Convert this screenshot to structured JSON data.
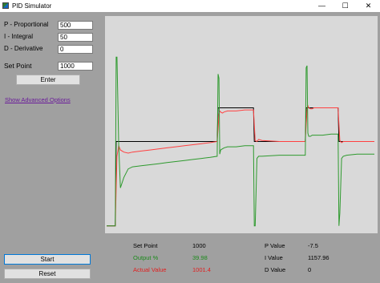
{
  "window": {
    "title": "PID Simulator",
    "minimize_glyph": "—",
    "maximize_glyph": "☐",
    "close_glyph": "✕"
  },
  "controls": {
    "p_label": "P - Proportional",
    "p_value": "500",
    "i_label": "I - Integral",
    "i_value": "50",
    "d_label": "D - Derivative",
    "d_value": "0",
    "setpoint_label": "Set Point",
    "setpoint_value": "1000",
    "enter_label": "Enter",
    "advanced_link": "Show Advanced Options",
    "start_label": "Start",
    "reset_label": "Reset"
  },
  "readouts": {
    "set_point_label": "Set Point",
    "set_point_value": "1000",
    "output_label": "Output %",
    "output_value": "39.98",
    "actual_label": "Actual Value",
    "actual_value": "1001.4",
    "p_label": "P Value",
    "p_value": "-7.5",
    "i_label": "I Value",
    "i_value": "1157.96",
    "d_label": "D Value",
    "d_value": "0"
  },
  "colors": {
    "setpoint_line": "#000000",
    "actual_line": "#ff4040",
    "output_line": "#2e9a2e",
    "chart_bg": "#d9d9d9",
    "window_bg": "#a0a0a0"
  },
  "chart_data": {
    "type": "line",
    "title": "",
    "xlabel": "",
    "ylabel": "",
    "x": [
      0,
      5,
      8,
      10,
      11,
      12,
      14,
      16,
      20,
      25,
      30,
      40,
      50,
      60,
      70,
      80,
      90,
      100,
      110,
      120,
      128,
      129,
      130,
      131,
      132,
      134,
      136,
      140,
      150,
      160,
      170,
      171,
      172,
      174,
      176,
      180,
      200,
      230,
      231,
      232,
      233,
      234,
      236,
      238,
      240,
      250,
      260,
      268,
      269,
      270,
      272,
      274,
      278,
      290,
      300,
      310
    ],
    "ylim": [
      0,
      100
    ],
    "series": [
      {
        "values": [
          2,
          2,
          2,
          2,
          42,
          42,
          42,
          42,
          42,
          42,
          42,
          42,
          42,
          42,
          42,
          42,
          42,
          42,
          42,
          42,
          42,
          58,
          58,
          58,
          58,
          58,
          58,
          58,
          58,
          58,
          58,
          42,
          42,
          42,
          42,
          42,
          42,
          42,
          58,
          58,
          58,
          58,
          58,
          58,
          58,
          58,
          58,
          58,
          42,
          42,
          42,
          42,
          42,
          42,
          42,
          42
        ]
      },
      {
        "values": [
          2,
          2,
          2,
          2,
          20,
          35,
          40,
          38,
          37,
          36.5,
          37,
          37.5,
          38,
          38.5,
          39,
          39.5,
          40,
          40.5,
          41,
          41.5,
          42,
          48,
          55,
          56.5,
          56,
          55.5,
          56,
          56.5,
          56.5,
          57,
          57,
          50,
          42.5,
          42,
          43,
          42.5,
          42,
          42,
          50,
          57,
          59,
          58,
          57.5,
          57.5,
          58,
          58,
          58,
          58,
          50,
          42.5,
          41.5,
          42,
          42,
          42,
          42,
          42
        ]
      },
      {
        "values": [
          2,
          2,
          2,
          2,
          82,
          82,
          40,
          20,
          25,
          29,
          30,
          30.5,
          31,
          31.5,
          32,
          32.5,
          33,
          33.5,
          34,
          34.5,
          35,
          74,
          72,
          36,
          38,
          38.5,
          39,
          39.5,
          39.5,
          40,
          40,
          2,
          2,
          34,
          35,
          35,
          35.5,
          35.5,
          77,
          78,
          46,
          44.5,
          44.5,
          45,
          45,
          45,
          45.5,
          45.5,
          2,
          8,
          34,
          35,
          35.5,
          36,
          36,
          36
        ]
      }
    ]
  }
}
